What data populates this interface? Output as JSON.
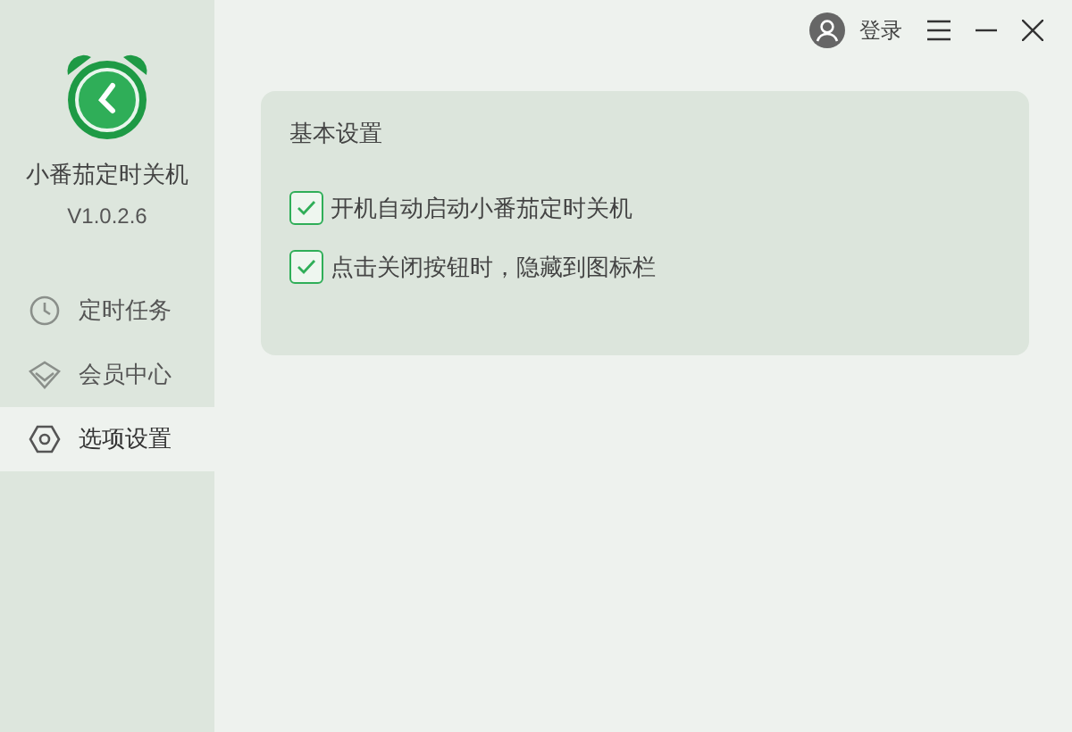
{
  "app": {
    "name": "小番茄定时关机",
    "version": "V1.0.2.6"
  },
  "sidebar": {
    "items": [
      {
        "label": "定时任务",
        "kind": "clock",
        "selected": false
      },
      {
        "label": "会员中心",
        "kind": "diamond",
        "selected": false
      },
      {
        "label": "选项设置",
        "kind": "gear",
        "selected": true
      }
    ]
  },
  "header": {
    "login": "登录"
  },
  "settings": {
    "title": "基本设置",
    "options": [
      {
        "label": "开机自动启动小番茄定时关机",
        "checked": true
      },
      {
        "label": "点击关闭按钮时，隐藏到图标栏",
        "checked": true
      }
    ]
  }
}
